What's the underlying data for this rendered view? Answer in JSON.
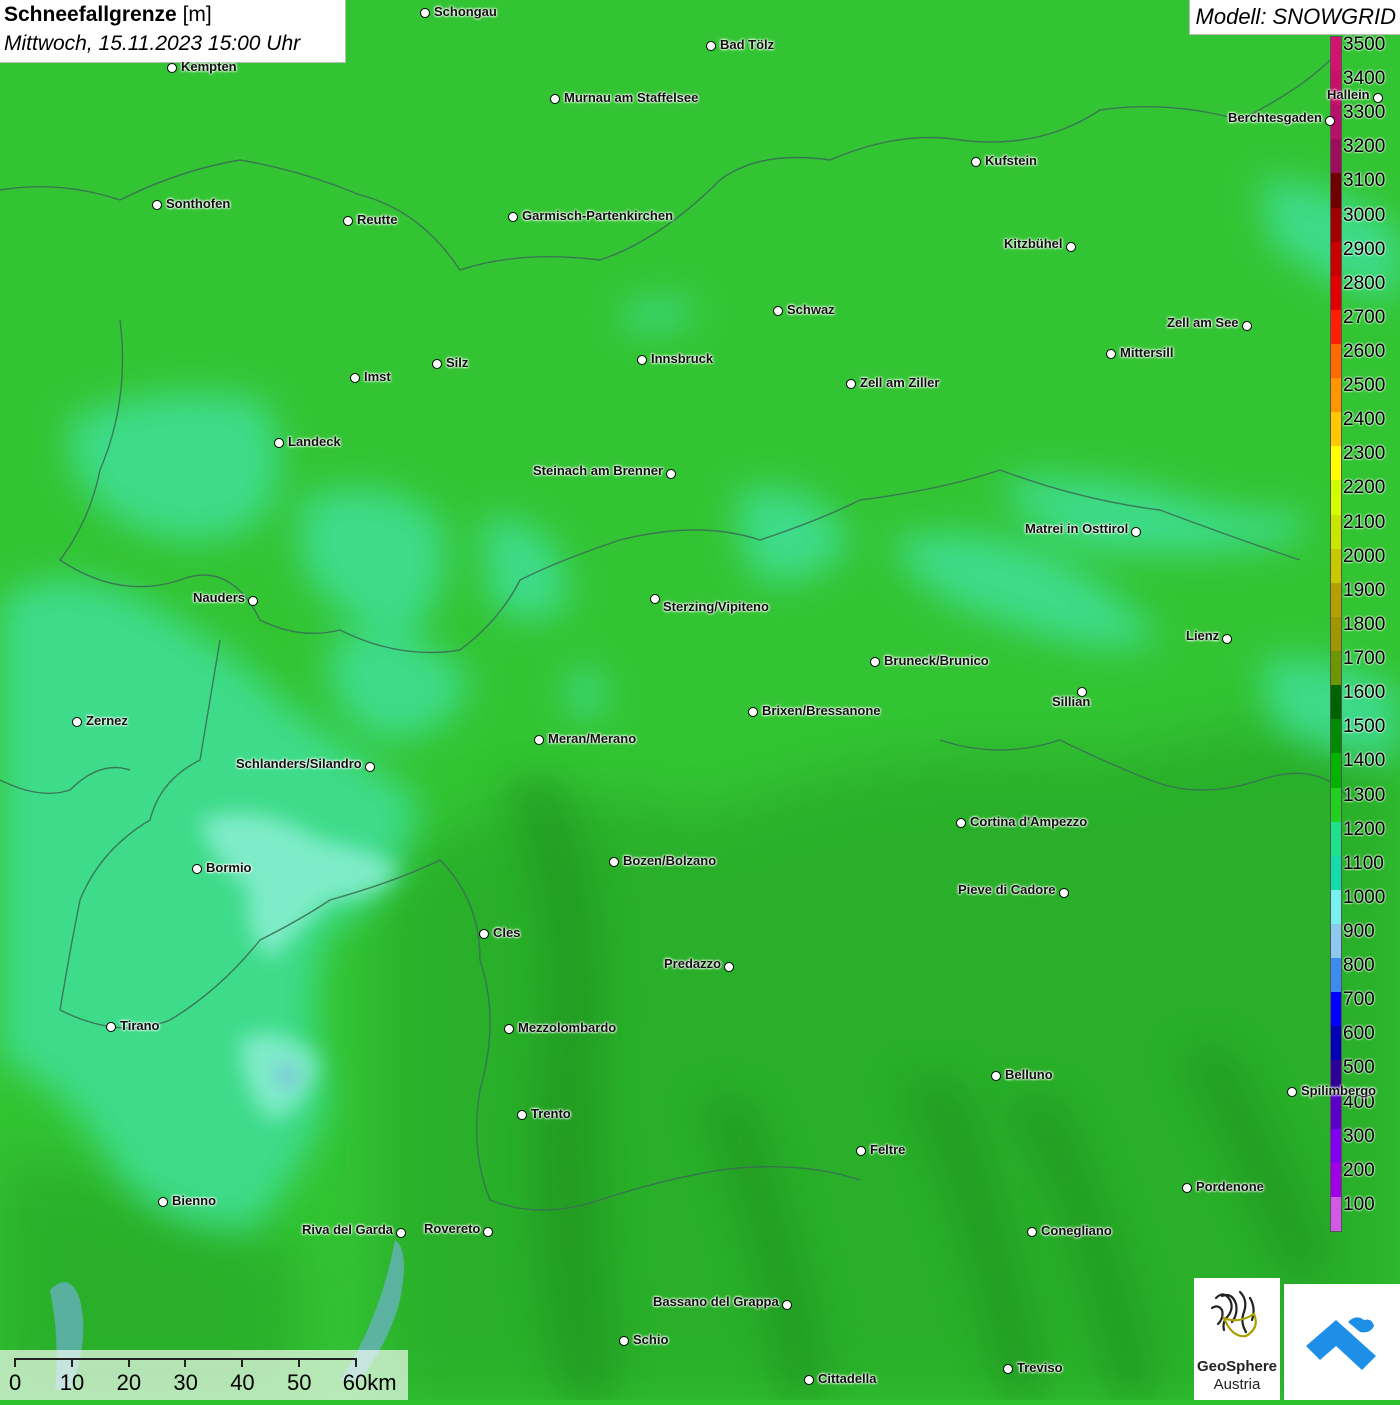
{
  "header": {
    "title_bold": "Schneefallgrenze",
    "title_unit": "[m]",
    "datetime": "Mittwoch, 15.11.2023 15:00 Uhr",
    "model": "Modell: SNOWGRID"
  },
  "legend": {
    "levels": [
      {
        "label": "3500",
        "color": "#d4126f"
      },
      {
        "label": "3400",
        "color": "#c8106a"
      },
      {
        "label": "3300",
        "color": "#b80f6a"
      },
      {
        "label": "3200",
        "color": "#9c0e5c"
      },
      {
        "label": "3100",
        "color": "#6e0000"
      },
      {
        "label": "3000",
        "color": "#a00000"
      },
      {
        "label": "2900",
        "color": "#c80000"
      },
      {
        "label": "2800",
        "color": "#e00000"
      },
      {
        "label": "2700",
        "color": "#ff1e00"
      },
      {
        "label": "2600",
        "color": "#ff6a00"
      },
      {
        "label": "2500",
        "color": "#ff9600"
      },
      {
        "label": "2400",
        "color": "#ffc800"
      },
      {
        "label": "2300",
        "color": "#ffff00"
      },
      {
        "label": "2200",
        "color": "#d2ff00"
      },
      {
        "label": "2100",
        "color": "#c8e600"
      },
      {
        "label": "2000",
        "color": "#c8c800"
      },
      {
        "label": "1900",
        "color": "#b4a000"
      },
      {
        "label": "1800",
        "color": "#a09600"
      },
      {
        "label": "1700",
        "color": "#6e9600"
      },
      {
        "label": "1600",
        "color": "#006400"
      },
      {
        "label": "1500",
        "color": "#008c00"
      },
      {
        "label": "1400",
        "color": "#00b400"
      },
      {
        "label": "1300",
        "color": "#1ed21e"
      },
      {
        "label": "1200",
        "color": "#1ee18c"
      },
      {
        "label": "1100",
        "color": "#14dcaa"
      },
      {
        "label": "1000",
        "color": "#78f0f0"
      },
      {
        "label": "900",
        "color": "#8cc8f0"
      },
      {
        "label": "800",
        "color": "#3c8cf0"
      },
      {
        "label": "700",
        "color": "#0000ff"
      },
      {
        "label": "600",
        "color": "#0000b4"
      },
      {
        "label": "500",
        "color": "#2d0096"
      },
      {
        "label": "400",
        "color": "#5a00c8"
      },
      {
        "label": "300",
        "color": "#8200f0"
      },
      {
        "label": "200",
        "color": "#a000e6"
      },
      {
        "label": "100",
        "color": "#d25ae6"
      }
    ]
  },
  "cities": [
    {
      "name": "Schongau"
    },
    {
      "name": "Bad Tölz"
    },
    {
      "name": "Kempten"
    },
    {
      "name": "Murnau am Staffelsee"
    },
    {
      "name": "Hallein"
    },
    {
      "name": "Berchtesgaden"
    },
    {
      "name": "Kufstein"
    },
    {
      "name": "Sonthofen"
    },
    {
      "name": "Reutte"
    },
    {
      "name": "Garmisch-Partenkirchen"
    },
    {
      "name": "Kitzbühel"
    },
    {
      "name": "Schwaz"
    },
    {
      "name": "Zell am See"
    },
    {
      "name": "Innsbruck"
    },
    {
      "name": "Mittersill"
    },
    {
      "name": "Imst"
    },
    {
      "name": "Silz"
    },
    {
      "name": "Zell am Ziller"
    },
    {
      "name": "Landeck"
    },
    {
      "name": "Steinach am Brenner"
    },
    {
      "name": "Matrei in Osttirol"
    },
    {
      "name": "Nauders"
    },
    {
      "name": "Sterzing/Vipiteno"
    },
    {
      "name": "Lienz"
    },
    {
      "name": "Bruneck/Brunico"
    },
    {
      "name": "Sillian"
    },
    {
      "name": "Brixen/Bressanone"
    },
    {
      "name": "Zernez"
    },
    {
      "name": "Meran/Merano"
    },
    {
      "name": "Schlanders/Silandro"
    },
    {
      "name": "Cortina d'Ampezzo"
    },
    {
      "name": "Bozen/Bolzano"
    },
    {
      "name": "Bormio"
    },
    {
      "name": "Pieve di Cadore"
    },
    {
      "name": "Cles"
    },
    {
      "name": "Predazzo"
    },
    {
      "name": "Tirano"
    },
    {
      "name": "Mezzolombardo"
    },
    {
      "name": "Belluno"
    },
    {
      "name": "Spilimbergo"
    },
    {
      "name": "Trento"
    },
    {
      "name": "Feltre"
    },
    {
      "name": "Pordenone"
    },
    {
      "name": "Bienno"
    },
    {
      "name": "Riva del Garda"
    },
    {
      "name": "Rovereto"
    },
    {
      "name": "Conegliano"
    },
    {
      "name": "Bassano del Grappa"
    },
    {
      "name": "Schio"
    },
    {
      "name": "Treviso"
    },
    {
      "name": "Cittadella"
    }
  ],
  "scale_bar": {
    "labels": [
      "0",
      "10",
      "20",
      "30",
      "40",
      "50",
      "60km"
    ]
  },
  "logos": {
    "geosphere_line1": "GeoSphere",
    "geosphere_line2": "Austria"
  }
}
